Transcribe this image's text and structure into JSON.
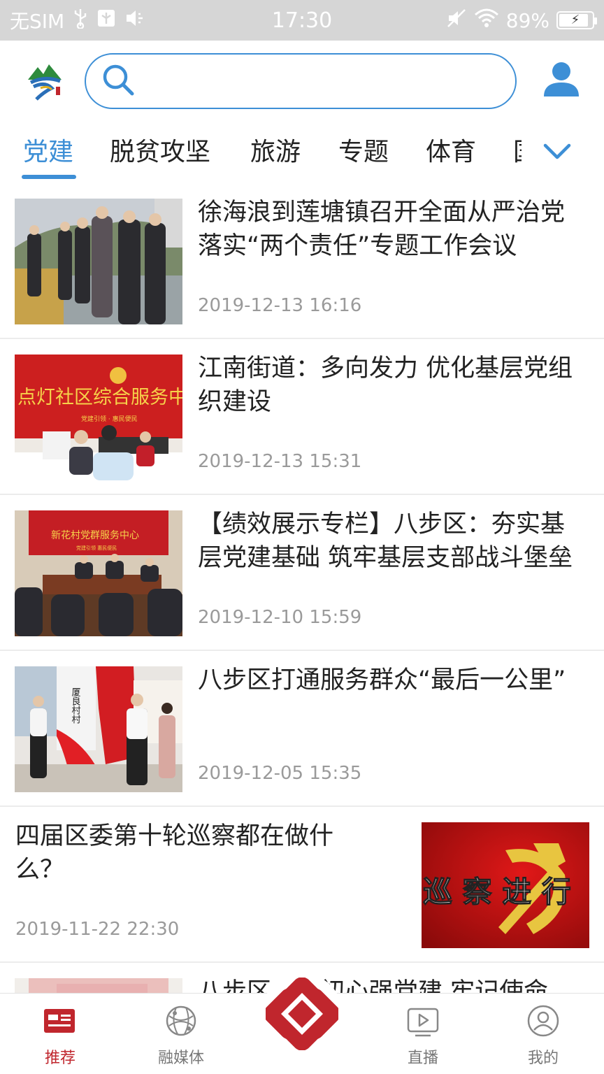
{
  "status_bar": {
    "carrier": "无SIM",
    "time": "17:30",
    "battery": "89%",
    "battery_level": 0.89
  },
  "header": {
    "logo_icon": "app-logo-mountain-icon",
    "search_placeholder": "",
    "user_icon": "user-icon"
  },
  "colors": {
    "accent_blue": "#3d8fd6",
    "brand_red": "#c0262d",
    "time_gray": "#9a9a9a"
  },
  "tabs": [
    {
      "label": "党建",
      "active": true
    },
    {
      "label": "脱贫攻坚",
      "active": false
    },
    {
      "label": "旅游",
      "active": false
    },
    {
      "label": "专题",
      "active": false
    },
    {
      "label": "体育",
      "active": false
    },
    {
      "label": "国",
      "active": false
    }
  ],
  "news": [
    {
      "title": "徐海浪到莲塘镇召开全面从严治党落实“两个责任”专题工作会议",
      "time": "2019-12-13 16:16"
    },
    {
      "title": "江南街道：多向发力  优化基层党组织建设",
      "time": "2019-12-13 15:31"
    },
    {
      "title": "【绩效展示专栏】八步区：夯实基层党建基础 筑牢基层支部战斗堡垒",
      "time": "2019-12-10 15:59"
    },
    {
      "title": "八步区打通服务群众“最后一公里”",
      "time": "2019-12-05 15:35"
    },
    {
      "title": "四届区委第十轮巡察都在做什么？",
      "time": "2019-11-22 22:30",
      "image_text": "巡 察 进 行"
    },
    {
      "title": "八步区：守初心强党建 牢记使命",
      "time": ""
    }
  ],
  "thumb_signs": {
    "item2": "点灯社区综合服务中心",
    "item2_sub": "党建引领 · 惠民便民",
    "item3": "新花村党群服务中心",
    "item3_sub": "党建引领 惠民便民",
    "item4": "厦良村村"
  },
  "bottom_nav": [
    {
      "label": "推荐",
      "icon": "newspaper-icon",
      "active": true
    },
    {
      "label": "融媒体",
      "icon": "globe-network-icon",
      "active": false
    },
    {
      "label": "",
      "icon": "center-diamond-logo-icon",
      "active": false
    },
    {
      "label": "直播",
      "icon": "play-video-icon",
      "active": false
    },
    {
      "label": "我的",
      "icon": "profile-icon",
      "active": false
    }
  ]
}
